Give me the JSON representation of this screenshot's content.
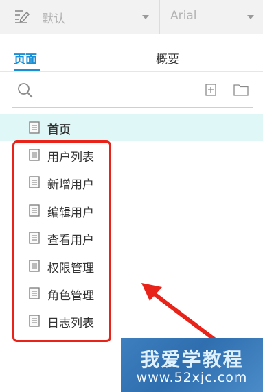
{
  "toolbar": {
    "style_value": "默认",
    "font_value": "Arial",
    "icons": [
      "style-edit-icon",
      "chevron-down-icon"
    ]
  },
  "tabs": [
    {
      "label": "页面",
      "active": true
    },
    {
      "label": "概要",
      "active": false
    }
  ],
  "search": {
    "icons": [
      "search-icon",
      "add-page-icon",
      "add-folder-icon"
    ]
  },
  "pages": [
    {
      "label": "首页",
      "selected": true
    },
    {
      "label": "用户列表",
      "selected": false
    },
    {
      "label": "新增用户",
      "selected": false
    },
    {
      "label": "编辑用户",
      "selected": false
    },
    {
      "label": "查看用户",
      "selected": false
    },
    {
      "label": "权限管理",
      "selected": false
    },
    {
      "label": "角色管理",
      "selected": false
    },
    {
      "label": "日志列表",
      "selected": false
    }
  ],
  "annotation": {
    "highlight_color": "#e8231a",
    "arrow_color": "#e8231a"
  },
  "watermark": {
    "title": "我爱学教程",
    "url": "www.52xjc.com"
  },
  "colors": {
    "accent": "#1a8fd6",
    "selected_row": "#e0f7f7"
  }
}
